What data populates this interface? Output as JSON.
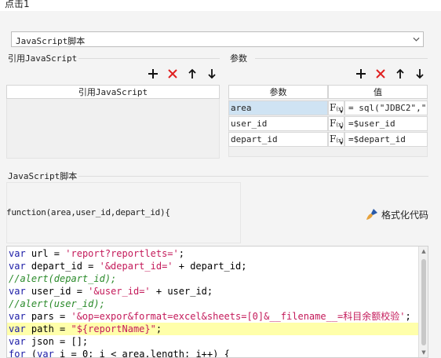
{
  "window": {
    "title": "点击1"
  },
  "script_type": {
    "selected": "JavaScript脚本"
  },
  "ref_section": {
    "label": "引用JavaScript",
    "column_header": "引用JavaScript"
  },
  "params_section": {
    "label": "参数",
    "columns": {
      "param": "参数",
      "value": "值"
    },
    "rows": [
      {
        "name": "area",
        "value": "= sql(\"JDBC2\",\"s",
        "selected": true
      },
      {
        "name": "user_id",
        "value": "=$user_id",
        "selected": false
      },
      {
        "name": "depart_id",
        "value": "=$depart_id",
        "selected": false
      }
    ]
  },
  "script_section": {
    "label": "JavaScript脚本",
    "signature": "function(area,user_id,depart_id){",
    "format_label": "格式化代码"
  },
  "code": {
    "lines": [
      "var url = 'report?reportlets=';",
      "var depart_id = '&depart_id=' + depart_id;",
      "//alert(depart_id);",
      "var user_id = '&user_id=' + user_id;",
      "//alert(user_id);",
      "var pars = '&op=expor&format=excel&sheets=[0]&__filename__=科目余额校验';",
      "var path = \"${reportName}\";",
      "var json = [];",
      "for (var i = 0; i < area.length; i++) {"
    ],
    "highlight_line": 7
  },
  "colors": {
    "keyword": "#1a1aa6",
    "string": "#c41a5a",
    "comment": "#2a8a2a",
    "add_icon": "#111111",
    "delete_icon": "#e02020",
    "highlight": "#ffffaa",
    "selected_row": "#cfe3f3"
  },
  "icons": {
    "add": "plus-icon",
    "delete": "x-icon",
    "up": "arrow-up-icon",
    "down": "arrow-down-icon",
    "format": "brush-icon",
    "fx": "formula-icon"
  }
}
